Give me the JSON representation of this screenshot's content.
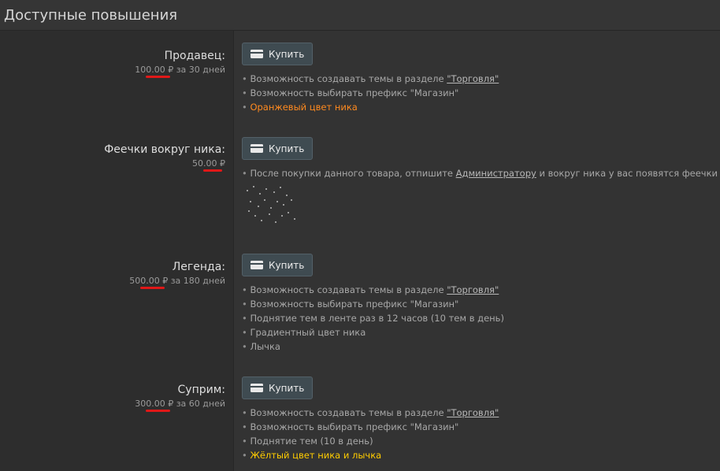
{
  "header": {
    "title": "Доступные повышения"
  },
  "buy_label": "Купить",
  "upgrades": [
    {
      "title": "Продавец:",
      "price": "100.00",
      "currency": "₽",
      "period": "за 30 дней",
      "features": [
        {
          "text": "Возможность создавать темы в разделе ",
          "link": "\"Торговля\""
        },
        {
          "text": "Возможность выбирать префикс \"Магазин\""
        },
        {
          "text": "Оранжевый цвет ника",
          "highlight": "orange"
        }
      ]
    },
    {
      "title": "Феечки вокруг ника:",
      "price": "50.00",
      "currency": "₽",
      "period": "",
      "features": [
        {
          "text": "После покупки данного товара, отпишите ",
          "link": "Администратору",
          "after": " и вокруг ника у вас появятся феечки"
        }
      ]
    },
    {
      "title": "Легенда:",
      "price": "500.00",
      "currency": "₽",
      "period": "за 180 дней",
      "features": [
        {
          "text": "Возможность создавать темы в разделе ",
          "link": "\"Торговля\""
        },
        {
          "text": "Возможность выбирать префикс \"Магазин\""
        },
        {
          "text": "Поднятие тем в ленте раз в 12 часов (10 тем в день)"
        },
        {
          "text": "Градиентный цвет ника"
        },
        {
          "text": "Лычка"
        }
      ]
    },
    {
      "title": "Суприм:",
      "price": "300.00",
      "currency": "₽",
      "period": "за 60 дней",
      "features": [
        {
          "text": "Возможность создавать темы в разделе ",
          "link": "\"Торговля\""
        },
        {
          "text": "Возможность выбирать префикс \"Магазин\""
        },
        {
          "text": "Поднятие тем (10 в день)"
        },
        {
          "text": "Жёлтый цвет ника и лычка",
          "highlight": "yellow"
        }
      ]
    }
  ],
  "colors": {
    "orange": "#ff8a1f",
    "yellow": "#ffcc00",
    "underline_red": "#e01818",
    "button_bg": "#3f4b51"
  },
  "icons": {
    "buy": "credit-card-icon",
    "sparkles": "sparkles-icon"
  }
}
